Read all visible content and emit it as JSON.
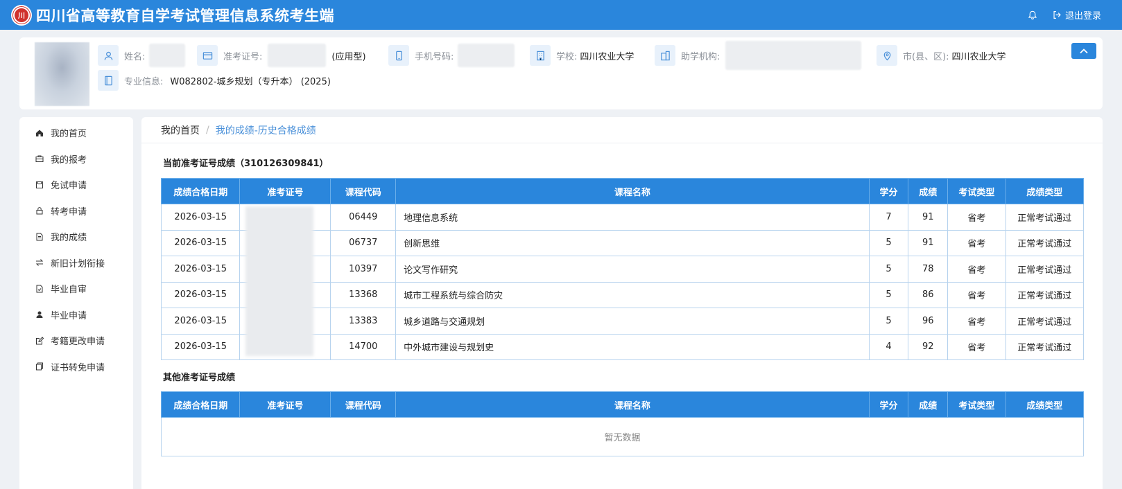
{
  "header": {
    "title": "四川省高等教育自学考试管理信息系统考生端",
    "logout_label": "退出登录"
  },
  "profile": {
    "name_label": "姓名:",
    "ticket_label": "准考证号:",
    "ticket_suffix": "(应用型)",
    "phone_label": "手机号码:",
    "school_label": "学校:",
    "school_value": "四川农业大学",
    "agency_label": "助学机构:",
    "city_label": "市(县、区):",
    "city_value": "四川农业大学",
    "major_label": "专业信息:",
    "major_value": "W082802-城乡规划（专升本） (2025)"
  },
  "sidebar": {
    "items": [
      {
        "label": "我的首页",
        "icon": "home-icon"
      },
      {
        "label": "我的报考",
        "icon": "briefcase-icon"
      },
      {
        "label": "免试申请",
        "icon": "save-icon"
      },
      {
        "label": "转考申请",
        "icon": "lock-icon"
      },
      {
        "label": "我的成绩",
        "icon": "document-icon"
      },
      {
        "label": "新旧计划衔接",
        "icon": "swap-icon"
      },
      {
        "label": "毕业自审",
        "icon": "check-document-icon"
      },
      {
        "label": "毕业申请",
        "icon": "user-icon"
      },
      {
        "label": "考籍更改申请",
        "icon": "edit-icon"
      },
      {
        "label": "证书转免申请",
        "icon": "copy-icon"
      }
    ]
  },
  "breadcrumb": {
    "home": "我的首页",
    "separator": "/",
    "current": "我的成绩-历史合格成绩"
  },
  "current_section": {
    "title": "当前准考证号成绩（310126309841）"
  },
  "other_section": {
    "title": "其他准考证号成绩",
    "empty_text": "暂无数据"
  },
  "table": {
    "columns": [
      "成绩合格日期",
      "准考证号",
      "课程代码",
      "课程名称",
      "学分",
      "成绩",
      "考试类型",
      "成绩类型"
    ],
    "rows": [
      {
        "date": "2026-03-15",
        "ticket": "",
        "code": "06449",
        "name": "地理信息系统",
        "credit": "7",
        "score": "91",
        "exam_type": "省考",
        "score_type": "正常考试通过"
      },
      {
        "date": "2026-03-15",
        "ticket": "",
        "code": "06737",
        "name": "创新思维",
        "credit": "5",
        "score": "91",
        "exam_type": "省考",
        "score_type": "正常考试通过"
      },
      {
        "date": "2026-03-15",
        "ticket": "",
        "code": "10397",
        "name": "论文写作研究",
        "credit": "5",
        "score": "78",
        "exam_type": "省考",
        "score_type": "正常考试通过"
      },
      {
        "date": "2026-03-15",
        "ticket": "",
        "code": "13368",
        "name": "城市工程系统与综合防灾",
        "credit": "5",
        "score": "86",
        "exam_type": "省考",
        "score_type": "正常考试通过"
      },
      {
        "date": "2026-03-15",
        "ticket": "",
        "code": "13383",
        "name": "城乡道路与交通规划",
        "credit": "5",
        "score": "96",
        "exam_type": "省考",
        "score_type": "正常考试通过"
      },
      {
        "date": "2026-03-15",
        "ticket": "",
        "code": "14700",
        "name": "中外城市建设与规划史",
        "credit": "4",
        "score": "92",
        "exam_type": "省考",
        "score_type": "正常考试通过"
      }
    ]
  },
  "colors": {
    "primary": "#2a86dc",
    "accent_text": "#4a90d9",
    "table_border": "#b7d3ee"
  }
}
